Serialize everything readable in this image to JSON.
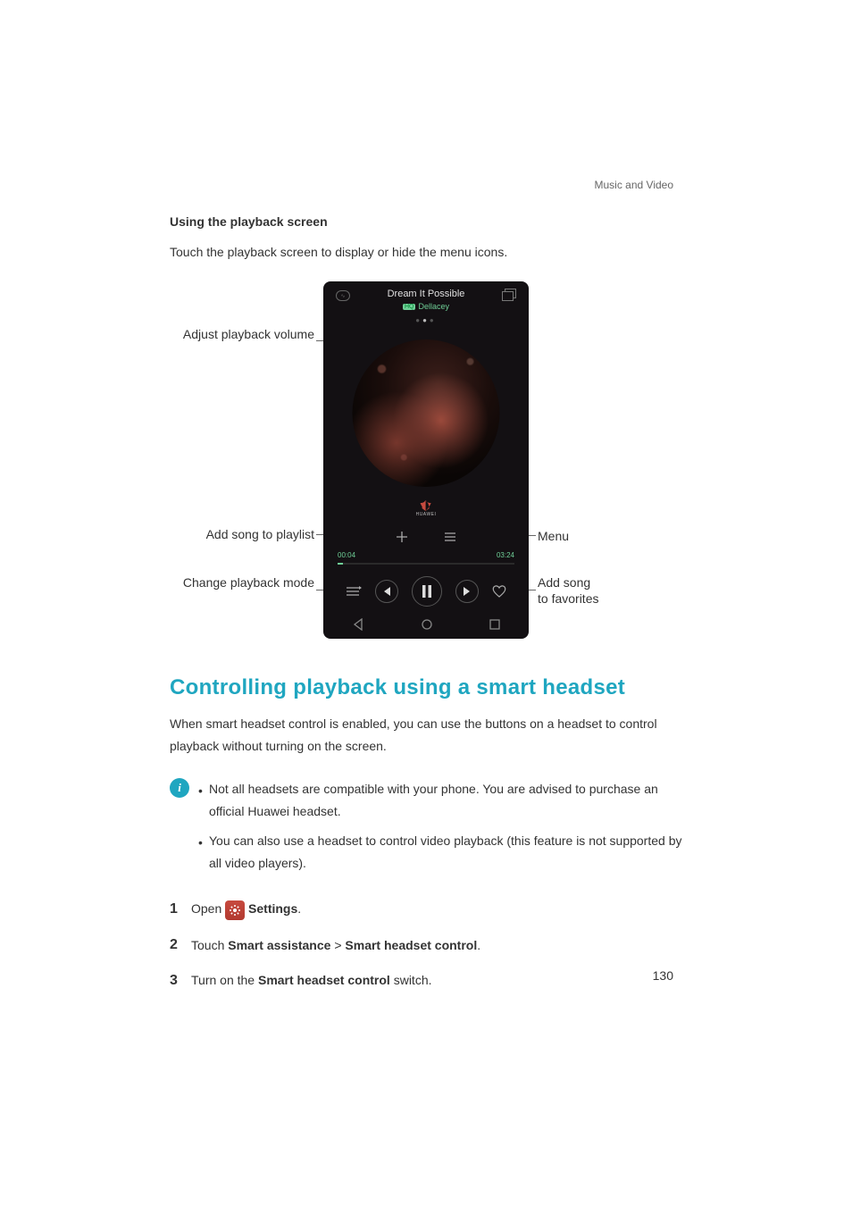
{
  "chapter": "Music and Video",
  "subheading": "Using the playback screen",
  "intro": "Touch the playback screen to display or hide the menu icons.",
  "player": {
    "track_title": "Dream It Possible",
    "hq_badge": "HQ",
    "artist": "Dellacey",
    "brand": "HUAWEI",
    "time_elapsed": "00:04",
    "time_total": "03:24"
  },
  "callouts": {
    "volume": "Adjust playback volume",
    "add_playlist": "Add song to playlist",
    "change_mode": "Change playback mode",
    "menu": "Menu",
    "favorites_l1": "Add song",
    "favorites_l2": "to favorites"
  },
  "heading2": "Controlling playback using a smart headset",
  "para2": "When smart headset control is enabled, you can use the buttons on a headset to control playback without turning on the screen.",
  "notes": {
    "n1": "Not all headsets are compatible with your phone. You are advised to purchase an official Huawei headset.",
    "n2": "You can also use a headset to control video playback (this feature is not supported by all video players)."
  },
  "steps": {
    "s1_prefix": "Open ",
    "s1_label": "Settings",
    "s1_suffix": ".",
    "s2_prefix": "Touch ",
    "s2_a": "Smart assistance",
    "s2_sep": " > ",
    "s2_b": "Smart headset control",
    "s2_suffix": ".",
    "s3_prefix": "Turn on the ",
    "s3_a": "Smart headset control",
    "s3_suffix": " switch."
  },
  "page_number": "130"
}
